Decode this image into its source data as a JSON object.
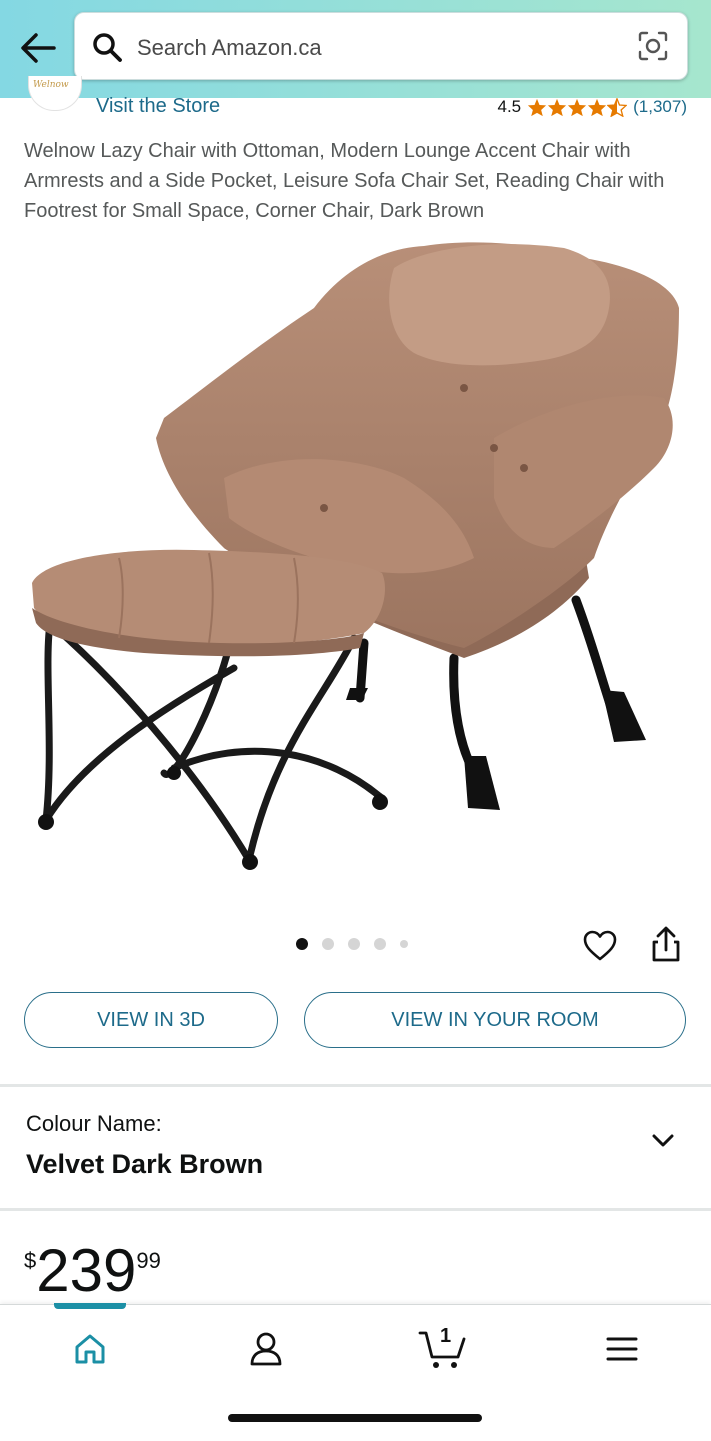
{
  "header": {
    "search_placeholder": "Search Amazon.ca",
    "gradient_left": "#84d8e3",
    "gradient_right": "#a6e6ce"
  },
  "store": {
    "logo_text": "Welnow",
    "visit_label": "Visit the Store",
    "rating": "4.5",
    "rating_count": "(1,307)",
    "star_color": "#e67a00"
  },
  "product": {
    "title": "Welnow Lazy Chair with Ottoman, Modern Lounge Accent Chair with Armrests and a Side Pocket, Leisure Sofa Chair Set, Reading Chair with Footrest for Small Space, Corner Chair, Dark Brown",
    "image_desc_icon": "chair-with-ottoman-image",
    "carousel_total": 5,
    "carousel_active": 1
  },
  "actions": {
    "view_3d": "VIEW IN 3D",
    "view_room": "VIEW IN YOUR ROOM",
    "accent": "#1d6a8a"
  },
  "colour": {
    "label": "Colour Name:",
    "value": "Velvet Dark Brown"
  },
  "price": {
    "currency": "$",
    "whole": "239",
    "fraction": "99"
  },
  "tabbar": {
    "items": [
      "home-icon",
      "account-icon",
      "cart-icon",
      "menu-icon"
    ],
    "cart_count": "1",
    "active_color": "#1b8fa5"
  }
}
